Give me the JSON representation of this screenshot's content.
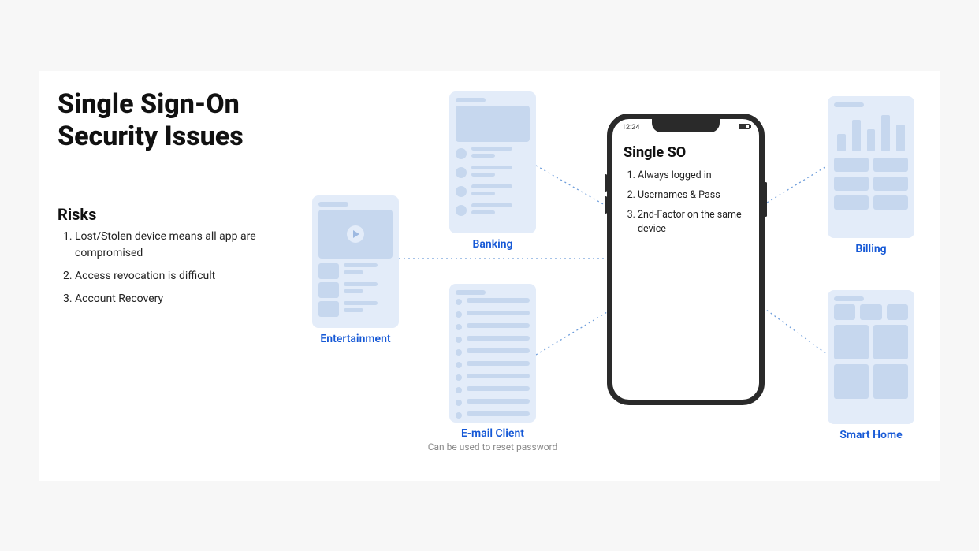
{
  "title_line1": "Single Sign-On",
  "title_line2": "Security Issues",
  "risks_heading": "Risks",
  "risks": [
    "Lost/Stolen device means all app are compromised",
    "Access revocation is difficult",
    "Account Recovery"
  ],
  "apps": {
    "entertainment": {
      "label": "Entertainment"
    },
    "banking": {
      "label": "Banking"
    },
    "email": {
      "label": "E-mail Client",
      "sub": "Can be used to reset password"
    },
    "billing": {
      "label": "Billing"
    },
    "smarthome": {
      "label": "Smart Home"
    }
  },
  "phone": {
    "status_time": "12:24",
    "title": "Single SO",
    "items": [
      "Always logged in",
      "Usernames & Pass",
      "2nd-Factor on the same device"
    ]
  },
  "colors": {
    "link": "#1558d6",
    "wire_bg": "#e3ecf9",
    "wire_fg": "#c6d7ee"
  }
}
